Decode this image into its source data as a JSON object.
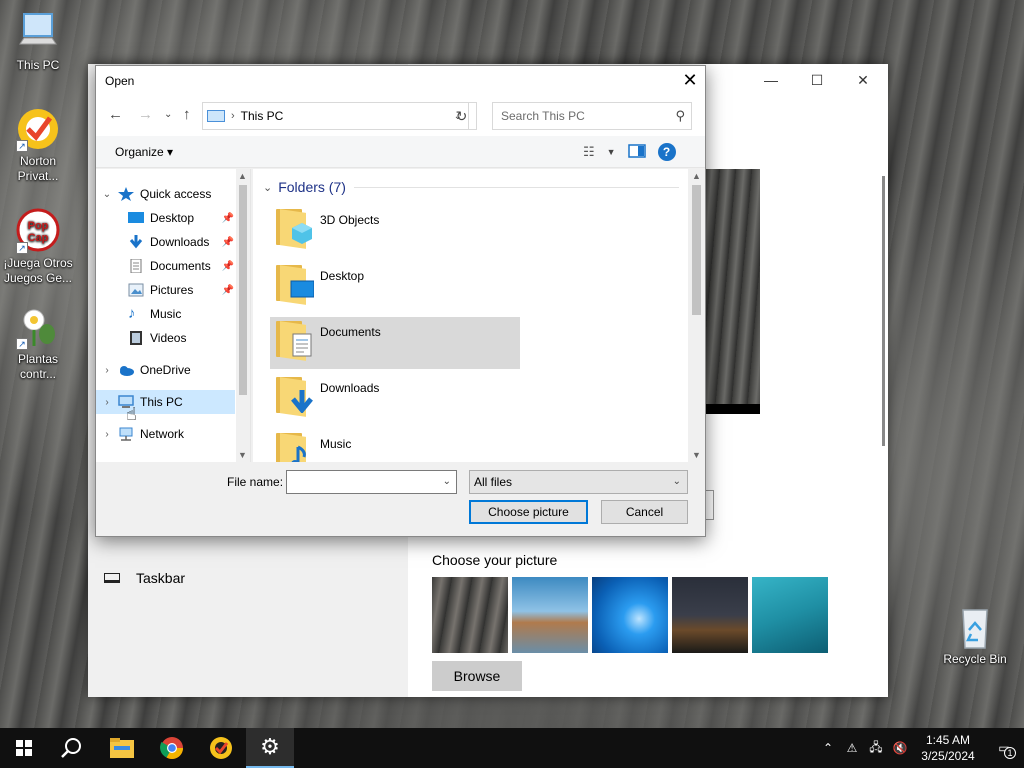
{
  "desktop": {
    "icons": [
      {
        "label": "This PC",
        "icon": "this-pc-icon"
      },
      {
        "label": "Norton Privat...",
        "icon": "norton-icon"
      },
      {
        "label": "¡Juega Otros Juegos Ge...",
        "icon": "popcap-icon"
      },
      {
        "label": "Plantas contr...",
        "icon": "plants-vs-zombies-icon"
      }
    ],
    "recycle_bin_label": "Recycle Bin"
  },
  "settings": {
    "nav_item_taskbar": "Taskbar",
    "choose_picture_label": "Choose your picture",
    "browse_label": "Browse",
    "window_controls": [
      "—",
      "☐",
      "✕"
    ],
    "thumb_colors": [
      "#5b5b58",
      "#3d8ac1",
      "#0a7fd7",
      "#2a2f3a",
      "#1f8fa4"
    ]
  },
  "dialog": {
    "title": "Open",
    "close_glyph": "✕",
    "address_path": "This PC",
    "search_placeholder": "Search This PC",
    "organize_label": "Organize ▾",
    "help_glyph": "?",
    "nav_tree": [
      {
        "label": "Quick access",
        "caret": "⌄",
        "icon": "star-icon",
        "pinned": false,
        "indent": 0
      },
      {
        "label": "Desktop",
        "caret": "",
        "icon": "desktop-folder-icon",
        "pinned": true,
        "indent": 1
      },
      {
        "label": "Downloads",
        "caret": "",
        "icon": "downloads-folder-icon",
        "pinned": true,
        "indent": 1
      },
      {
        "label": "Documents",
        "caret": "",
        "icon": "documents-folder-icon",
        "pinned": true,
        "indent": 1
      },
      {
        "label": "Pictures",
        "caret": "",
        "icon": "pictures-folder-icon",
        "pinned": true,
        "indent": 1
      },
      {
        "label": "Music",
        "caret": "",
        "icon": "music-folder-icon",
        "pinned": false,
        "indent": 1
      },
      {
        "label": "Videos",
        "caret": "",
        "icon": "videos-folder-icon",
        "pinned": false,
        "indent": 1
      },
      {
        "label": "OneDrive",
        "caret": "›",
        "icon": "onedrive-icon",
        "pinned": false,
        "indent": 0
      },
      {
        "label": "This PC",
        "caret": "›",
        "icon": "this-pc-icon",
        "pinned": false,
        "indent": 0
      },
      {
        "label": "Network",
        "caret": "›",
        "icon": "network-icon",
        "pinned": false,
        "indent": 0
      }
    ],
    "folders_header": "Folders (7)",
    "folders": [
      {
        "name": "3D Objects",
        "overlay": "3d-objects-icon"
      },
      {
        "name": "Desktop",
        "overlay": "desktop-icon"
      },
      {
        "name": "Documents",
        "overlay": "documents-icon"
      },
      {
        "name": "Downloads",
        "overlay": "download-arrow-icon"
      },
      {
        "name": "Music",
        "overlay": "music-note-icon"
      }
    ],
    "file_name_label": "File name:",
    "file_name_value": "",
    "file_type_value": "All files",
    "choose_button": "Choose picture",
    "cancel_button": "Cancel"
  },
  "taskbar": {
    "apps": [
      "start-icon",
      "search-icon",
      "file-explorer-icon",
      "chrome-icon",
      "norton-icon",
      "settings-gear-icon"
    ],
    "time": "1:45 AM",
    "date": "3/25/2024",
    "notification_count": "1"
  },
  "colors": {
    "accent": "#0078d7",
    "folder_yellow": "#f8d775",
    "selection": "#cce8ff",
    "hover": "#d9d9d9"
  }
}
